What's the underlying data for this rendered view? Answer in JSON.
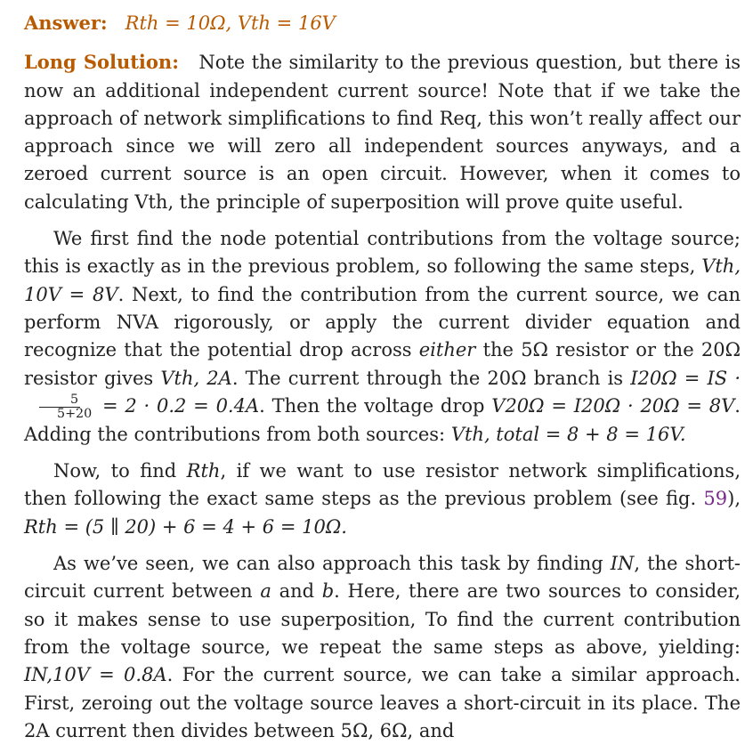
{
  "answer": {
    "label": "Answer:",
    "text": "Rth = 10Ω, Vth = 16V"
  },
  "long_solution": {
    "label": "Long Solution:",
    "p1": "Note the similarity to the previous question, but there is now an additional independent current source! Note that if we take the approach of network simplifications to find Req, this won’t really affect our approach since we will zero all independent sources anyways, and a zeroed current source is an open circuit. However, when it comes to calculating Vth, the principle of superposition will prove quite useful."
  },
  "p2": {
    "a": "We first find the node potential contributions from the voltage source; this is exactly as in the previous problem, so following the same steps, ",
    "vth10v": "Vth, 10V = 8V",
    "b": ". Next, to find the contribution from the current source, we can perform NVA rigorously, or apply the current divider equation and recognize that the potential drop across ",
    "either": "either",
    "c": " the 5Ω resistor or the 20Ω resistor gives ",
    "vth2a": "Vth, 2A",
    "d": ". The current through the 20Ω branch is ",
    "eq1a": "I20Ω = IS ·",
    "frac_num": "5",
    "frac_den": "5+20",
    "eq1b": "= 2 · 0.2 = 0.4A",
    "e": ". Then the voltage drop ",
    "eq2": "V20Ω = I20Ω · 20Ω = 8V",
    "f": ". Adding the contributions from both sources: ",
    "eq3": "Vth, total = 8 + 8 = 16V."
  },
  "p3": {
    "a": "Now, to find ",
    "rth": "Rth",
    "b": ", if we want to use resistor network simplifications, then following the exact same steps as the previous problem (see fig. ",
    "fig_ref": "59",
    "c": "), ",
    "eq": "Rth = (5 ∥ 20) + 6 = 4 + 6 = 10Ω."
  },
  "p4": {
    "a": "As we’ve seen, we can also approach this task by finding ",
    "in": "IN",
    "b": ", the short-circuit current between ",
    "node_a": "a",
    "c": " and ",
    "node_b": "b",
    "d": ". Here, there are two sources to consider, so it makes sense to use superposition, To find the current contribution from the voltage source, we repeat the same steps as above, yielding: ",
    "eq": "IN,10V = 0.8A",
    "e": ". For the current source, we can take a similar approach. First, zeroing out the voltage source leaves a short-circuit in its place. The 2A current then divides between 5Ω, 6Ω, and"
  }
}
